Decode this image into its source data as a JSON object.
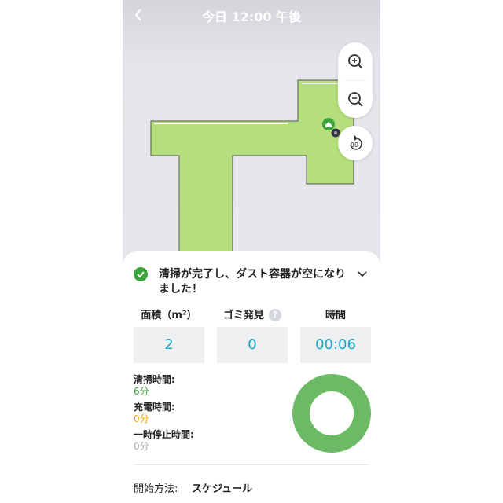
{
  "header": {
    "title": "今日 12:00 午後",
    "back_icon": "chevron-left-icon"
  },
  "map_controls": {
    "zoom_in_icon": "zoom-in-icon",
    "zoom_out_icon": "zoom-out-icon",
    "rotate_label": "90",
    "rotate_icon": "rotate-icon"
  },
  "map": {
    "area_color": "#b4df7c",
    "dock_icon": "home-icon",
    "robot_icon": "robot-icon"
  },
  "status": {
    "icon": "check-circle-icon",
    "message": "清掃が完了し、ダスト容器が空になりました！",
    "expand_icon": "chevron-down-icon",
    "color": "#3aa33a"
  },
  "stats": [
    {
      "label": "面積（m²）",
      "value": "2"
    },
    {
      "label": "ゴミ発見",
      "value": "0",
      "help": "?"
    },
    {
      "label": "時間",
      "value": "00:06"
    }
  ],
  "times": [
    {
      "label": "清掃時間:",
      "value": "6分",
      "color": "#3aa33a"
    },
    {
      "label": "充電時間:",
      "value": "0分",
      "color": "#f2a900"
    },
    {
      "label": "一時停止時間:",
      "value": "0分",
      "color": "#aaaaaa"
    }
  ],
  "breakdown": {
    "cleaning_fraction": 1.0,
    "charging_fraction": 0.0,
    "paused_fraction": 0.0,
    "color": "#6cba66"
  },
  "start_method": {
    "label": "開始方法:",
    "value": "スケジュール"
  }
}
